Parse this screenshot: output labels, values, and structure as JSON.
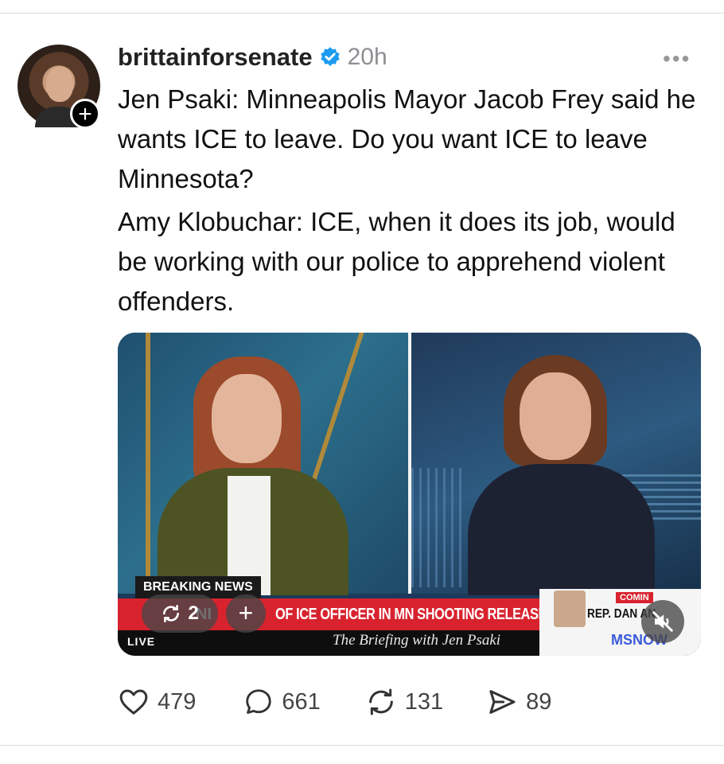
{
  "post": {
    "username": "brittainforsenate",
    "time": "20h",
    "more_label": "•••",
    "paragraphs": [
      "Jen Psaki: Minneapolis Mayor Jacob Frey said he wants ICE to leave. Do you want ICE to leave Minnesota?",
      "Amy Klobuchar: ICE, when it does its job, would be working with our police to apprehend violent offenders."
    ]
  },
  "video": {
    "breaking_label": "BREAKING NEWS",
    "ticker_fragment": "NI",
    "ticker_text": "OF ICE OFFICER IN MN SHOOTING RELEASED",
    "live_label": "LIVE",
    "show_title": "The Briefing with Jen Psaki",
    "coming_label": "COMIN",
    "rep_label": "REP. DAN          AN",
    "network_label": "MSNOW",
    "repost_count": "2",
    "plus_label": "+"
  },
  "actions": {
    "likes": "479",
    "replies": "661",
    "reposts": "131",
    "shares": "89"
  },
  "colors": {
    "verified": "#1d9bf0",
    "ticker_red": "#d8232f"
  },
  "icons": [
    "verified-badge-icon",
    "more-icon",
    "follow-plus-icon",
    "repost-icon",
    "mute-icon",
    "heart-icon",
    "reply-icon",
    "share-icon"
  ]
}
